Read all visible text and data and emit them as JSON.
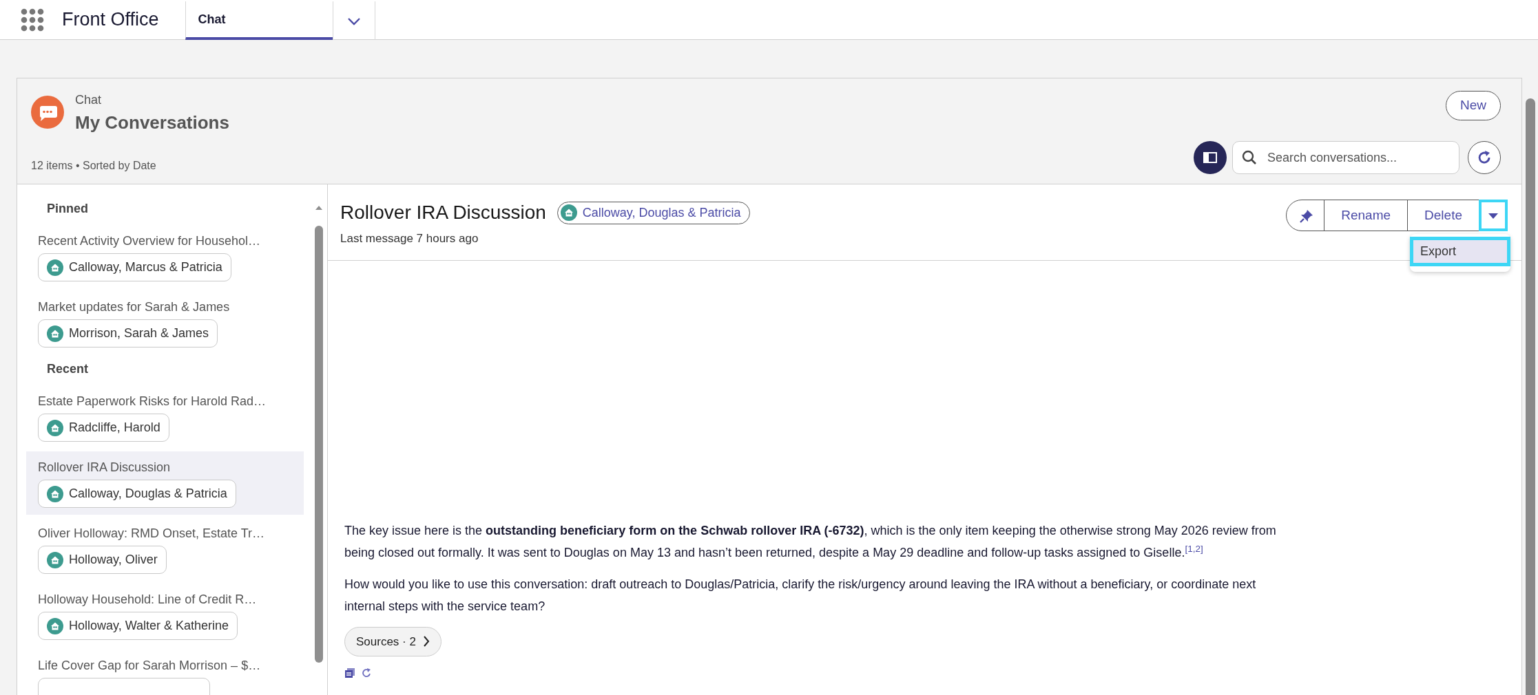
{
  "app": {
    "title": "Front Office"
  },
  "tabs": [
    {
      "label": "Chat",
      "selected": true
    }
  ],
  "card": {
    "eyebrow": "Chat",
    "title": "My Conversations",
    "meta": "12 items • Sorted by Date",
    "new_button": "New",
    "search": {
      "placeholder": "Search conversations..."
    }
  },
  "sidebar": {
    "sections": [
      {
        "heading": "Pinned",
        "items": [
          {
            "title": "Recent Activity Overview for Househol…",
            "household": "Calloway, Marcus & Patricia",
            "selected": false
          },
          {
            "title": "Market updates for Sarah & James",
            "household": "Morrison, Sarah & James",
            "selected": false
          }
        ]
      },
      {
        "heading": "Recent",
        "items": [
          {
            "title": "Estate Paperwork Risks for Harold Rad…",
            "household": "Radcliffe, Harold",
            "selected": false
          },
          {
            "title": "Rollover IRA Discussion",
            "household": "Calloway, Douglas & Patricia",
            "selected": true
          },
          {
            "title": "Oliver Holloway: RMD Onset, Estate Tr…",
            "household": "Holloway, Oliver",
            "selected": false
          },
          {
            "title": "Holloway Household: Line of Credit R…",
            "household": "Holloway, Walter & Katherine",
            "selected": false
          },
          {
            "title": "Life Cover Gap for Sarah Morrison – $…",
            "selected": false
          }
        ]
      }
    ]
  },
  "conversation": {
    "title": "Rollover IRA Discussion",
    "household": "Calloway, Douglas & Patricia",
    "subtitle": "Last message 7 hours ago",
    "actions": [
      "Rename",
      "Delete"
    ],
    "menu_expanded": true,
    "menu": [
      {
        "label": "Export",
        "selected": true
      }
    ],
    "messages": [
      "The key issue here is the **outstanding beneficiary form on the Schwab rollover IRA (-6732)**, which is the only item keeping the otherwise strong May 2026 review from being closed out formally. It was sent to Douglas on May 13 and hasn’t been returned, despite a May 29 deadline and follow-up tasks assigned to Giselle.$^{[1,2]}$",
      "How would you like to use this conversation: draft outreach to Douglas/Patricia, clarify the risk/urgency around leaving the IRA without a beneficiary, or coordinate next internal steps with the service team?"
    ],
    "sources_button": "Sources · 2"
  }
}
